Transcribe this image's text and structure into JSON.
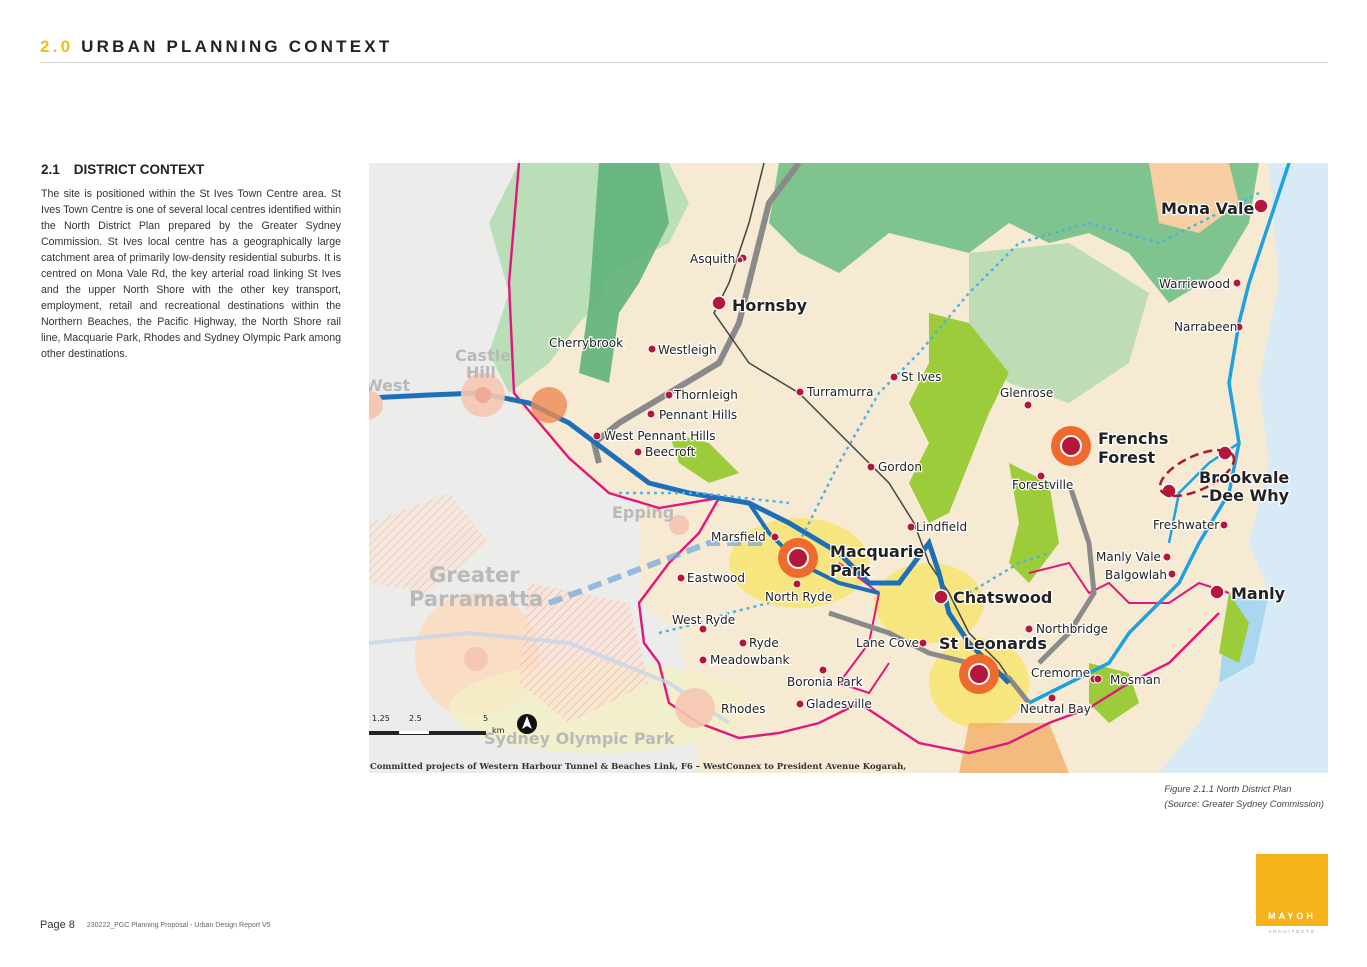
{
  "header": {
    "number": "2.0",
    "title": "URBAN PLANNING CONTEXT"
  },
  "section": {
    "number": "2.1",
    "title": "DISTRICT CONTEXT",
    "body": "The site is positioned within the St Ives Town Centre area. St Ives Town Centre is one of several local centres identified within the North District Plan prepared by the Greater Sydney Commission. St Ives local centre has a geographically large catchment area of primarily low-density residential suburbs. It is centred on Mona Vale Rd, the key arterial road linking St Ives and the upper North Shore with the other key transport, employment, retail and recreational destinations within the Northern Beaches, the Pacific Highway, the North Shore rail line, Macquarie Park, Rhodes and Sydney Olympic Park among other destinations."
  },
  "map": {
    "major_centres": [
      "Hornsby",
      "Macquarie",
      "Park",
      "Chatswood",
      "St Leonards",
      "Frenchs",
      "Forest",
      "Brookvale",
      "–Dee Why",
      "Mona Vale",
      "Manly"
    ],
    "local_centres": [
      "Asquith",
      "Cherrybrook",
      "Westleigh",
      "Thornleigh",
      "Pennant Hills",
      "West Pennant Hills",
      "Beecroft",
      "Turramurra",
      "St Ives",
      "Gordon",
      "Lindfield",
      "Glenrose",
      "Forestville",
      "Marsfield",
      "Eastwood",
      "North Ryde",
      "West Ryde",
      "Ryde",
      "Meadowbank",
      "Boronia Park",
      "Gladesville",
      "Lane Cove",
      "Northbridge",
      "Cremorne",
      "Mosman",
      "Neutral Bay",
      "Warriewood",
      "Narrabeen",
      "Freshwater",
      "Manly Vale",
      "Balgowlah",
      "Rhodes"
    ],
    "outside_labels": [
      "Castle",
      "Hill",
      "West",
      "Epping",
      "Greater",
      "Parramatta",
      "Sydney Olympic Park"
    ],
    "scale": {
      "ticks": [
        "1.25",
        "2.5",
        "5"
      ],
      "unit": "km"
    },
    "note": "Committed projects of Western Harbour Tunnel & Beaches Link, F6 – WestConnex to President Avenue Kogarah,"
  },
  "caption": {
    "line1": "Figure 2.1.1 North District Plan",
    "line2": "(Source: Greater Sydney Commission)"
  },
  "footer": {
    "page": "Page 8",
    "doc": "230222_PGC Planning Proposal - Urban Design Report V5"
  },
  "logo": {
    "name": "MAYOH",
    "sub": "ARCHITECTS"
  },
  "colors": {
    "accent": "#f2be1a",
    "logo_bg": "#f5b21b",
    "centre_red": "#b5173a",
    "rail_blue": "#1d6fb8"
  }
}
